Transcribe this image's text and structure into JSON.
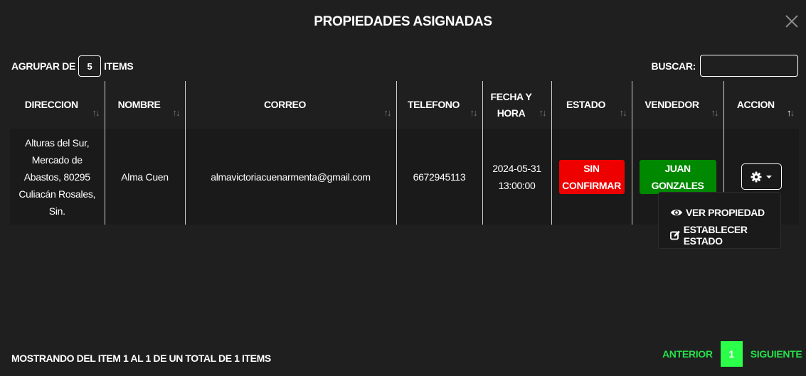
{
  "modal": {
    "title": "PROPIEDADES ASIGNADAS"
  },
  "toolbar": {
    "group_prefix": "AGRUPAR DE",
    "group_value": "5",
    "group_suffix": "ITEMS",
    "search_label": "BUSCAR:",
    "search_value": ""
  },
  "table": {
    "columns": [
      "DIRECCION",
      "NOMBRE",
      "CORREO",
      "TELEFONO",
      "FECHA Y HORA",
      "ESTADO",
      "VENDEDOR",
      "ACCION"
    ],
    "sorted_column": "ACCION",
    "rows": [
      {
        "direccion": "Alturas del Sur, Mercado de Abastos, 80295 Culiacán Rosales, Sin.",
        "nombre": "Alma Cuen",
        "correo": "almavictoriacuenarmenta@gmail.com",
        "telefono": "6672945113",
        "fecha": "2024-05-31 13:00:00",
        "estado": "SIN CONFIRMAR",
        "vendedor": "JUAN GONZALES"
      }
    ]
  },
  "action_menu": {
    "items": [
      {
        "label": "VER PROPIEDAD",
        "icon": "eye-icon"
      },
      {
        "label": "ESTABLECER ESTADO",
        "icon": "edit-icon"
      }
    ]
  },
  "footer": {
    "info": "MOSTRANDO DEL ITEM 1 AL 1 DE UN TOTAL DE 1 ITEMS"
  },
  "pagination": {
    "prev": "ANTERIOR",
    "current": "1",
    "next": "SIGUIENTE"
  },
  "colors": {
    "background": "#1f1f1f",
    "status_badge": "#ee0000",
    "seller_badge": "#008800",
    "pagination_accent": "#2bff4a"
  }
}
